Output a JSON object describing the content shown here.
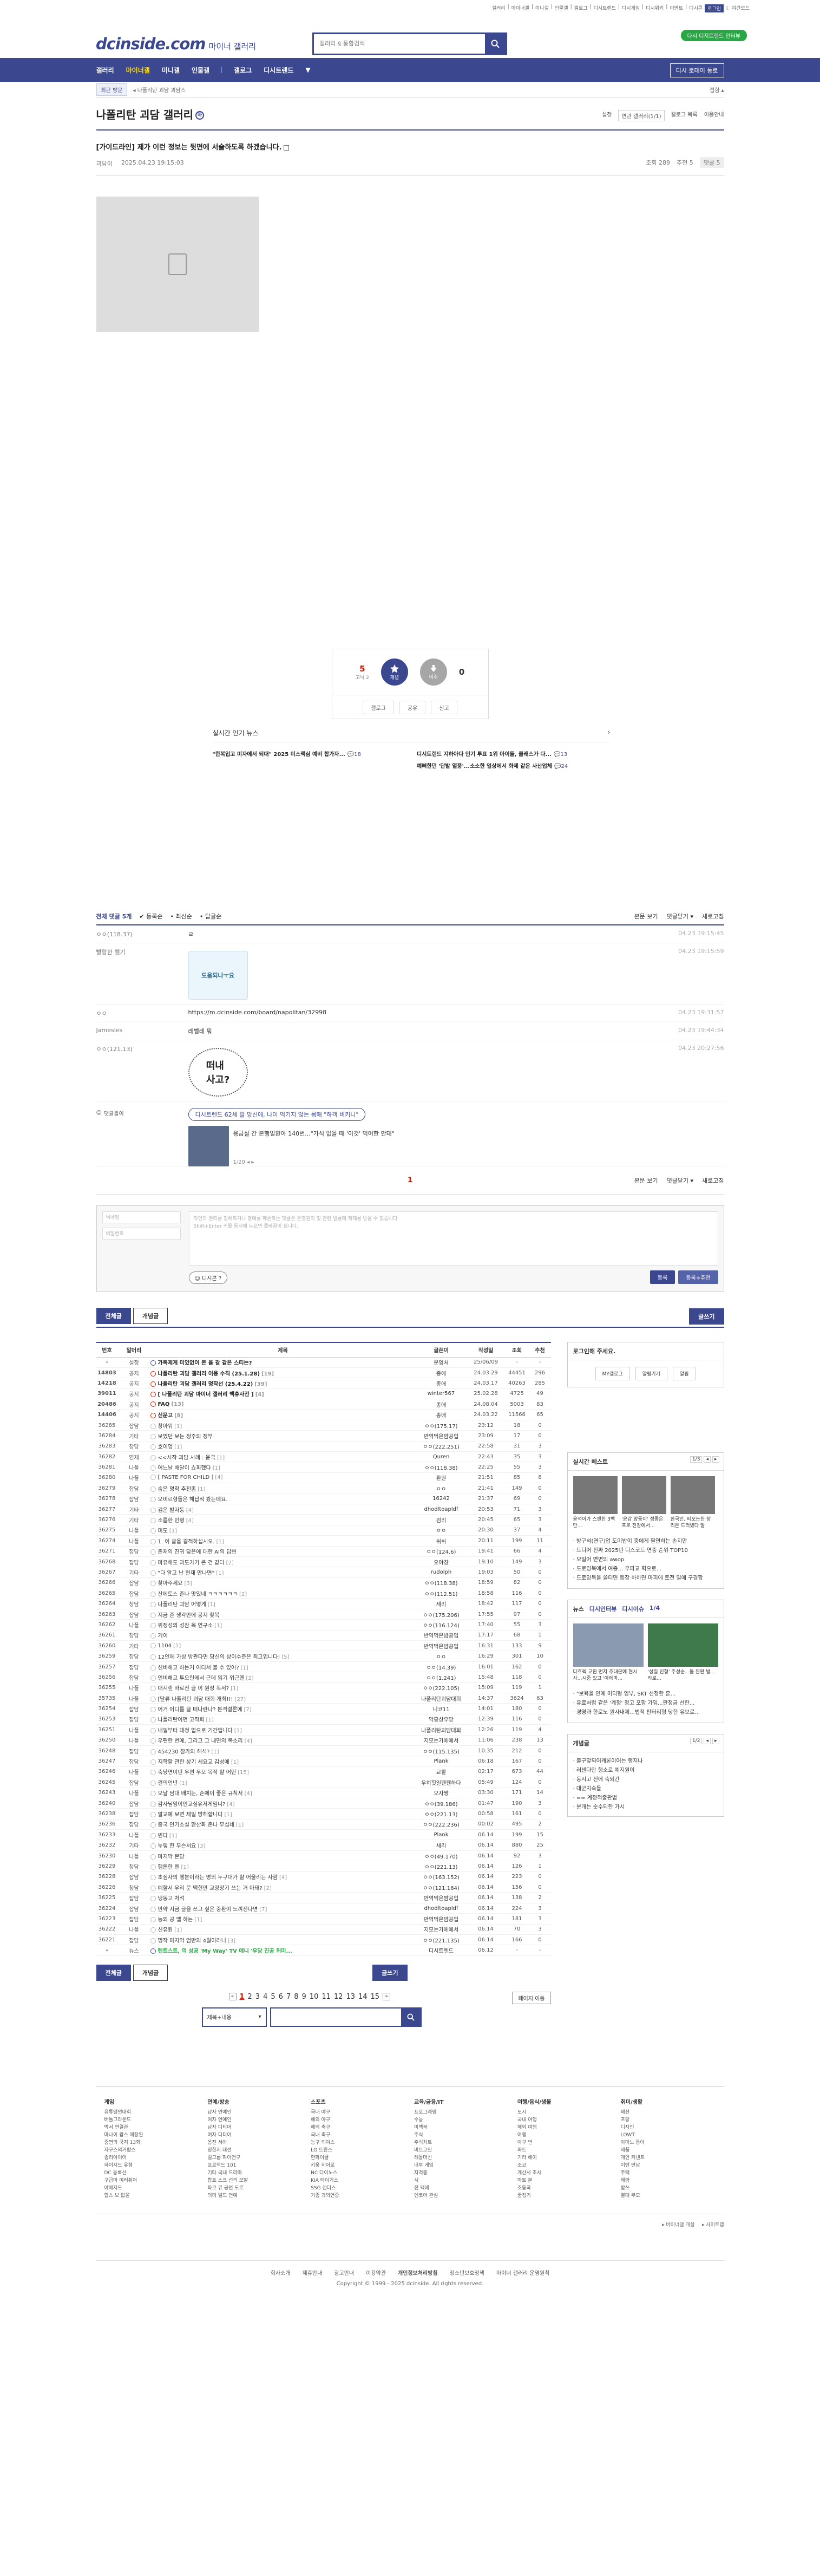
{
  "toplinks": [
    "갤러리",
    "마이너갤",
    "미니갤",
    "인물갤",
    "갤로그",
    "디시트렌드",
    "디시게임",
    "디시위키",
    "이벤트",
    "디시콘"
  ],
  "login_label": "로그인",
  "brightness_label": "야간모드",
  "green_pill": "다시 디지트렌드 인터뷰",
  "logo_main": "dcinside.com",
  "logo_sub": "마이너 갤러리",
  "search_placeholder": "갤러리 & 통합검색",
  "gnb": [
    "갤러리",
    "마이너갤",
    "미니갤",
    "인물갤",
    "갤로그",
    "디시트렌드"
  ],
  "gnb_more": "▼",
  "history_label": "최근 방문",
  "history_btn": "디시 로테이 동로",
  "subbar_recent": "최근 방문",
  "subbar_crumb": "나폴리탄 괴담",
  "subbar_fold": "접힘",
  "gallery_title": "나폴리탄 괴담 갤러리",
  "gallery_badge": "마",
  "gallery_options": [
    "설정",
    "연관 갤러리(1/1)",
    "갤로그 목록",
    "이용안내"
  ],
  "post": {
    "title": "[가이드라인] 제가 이런 정보는 뒷면에 서술하도록 하겠습니다.",
    "author": "괴담이",
    "date": "2025.04.23 19:15:03",
    "views": "조회 289",
    "recommend": "추천 5",
    "comments": "댓글 5"
  },
  "vote": {
    "up": "5",
    "up_sub": "고닉 2",
    "up_label": "개념",
    "down": "0",
    "down_label": "비추"
  },
  "vote_actions": [
    "갤로그",
    "공유",
    "신고"
  ],
  "news": {
    "title": "실시간 인기 뉴스",
    "left": [
      {
        "title": "\"한복입고 미자에서 되대\" 2025 미스맥심 예비 합가자...",
        "count": "18"
      },
      {
        "title": "",
        "count": ""
      }
    ],
    "right": [
      {
        "title": "디시트렌드 지하아다 인기 투표 1위 아이돌, 클래스가 다...",
        "count": "13"
      },
      {
        "title": "예뻐한던 '단발 열풍'...소소한 일상에서 화제 같은 사산업체",
        "count": "24"
      }
    ]
  },
  "comment_head": {
    "total": "전체 댓글 5개",
    "sort": [
      "등록순",
      "최신순",
      "답글순"
    ],
    "right": [
      "본문 보기",
      "댓글닫기 ▾",
      "새로고침"
    ]
  },
  "comments": [
    {
      "nick": "ㅇㅇ(118.37)",
      "text": "ㄹ",
      "date": "04.23 19:15:45"
    },
    {
      "nick": "빨랑한 헬기",
      "text": "",
      "date": "04.23 19:15:59",
      "dccon": "도움되나ㅜ요"
    },
    {
      "nick": "ㅇㅇ",
      "text": "https://m.dcinside.com/board/napolitan/32998",
      "date": "04.23 19:31:57"
    },
    {
      "nick": "Jamesles",
      "text": "레벨레 뭐",
      "date": "04.23 19:44:34"
    },
    {
      "nick": "ㅇㅇ(121.13)",
      "text": "",
      "date": "04.23 20:27:56",
      "dccon": "떠내\n사고?"
    }
  ],
  "reply_label": "댓글돌이",
  "reply_pill_text": "디시트렌드 62세 할 망신에, 나이 먹기지 않는 몸매 \"하객 비키니\"",
  "reply_article": "응급실 간 본행일환아 140번...\"가식 없을 때 '이것' 먹어한 안돼\"",
  "reply_page": "1/20",
  "comment_page": "1",
  "write": {
    "nick_placeholder": "닉네임",
    "pw_placeholder": "비밀번호",
    "ta_placeholder": "타인의 권리를 침해하거나 명예를 훼손하는 댓글은 운영원칙 및 관련 법률에 제재를 받을 수 있습니다.\nShift+Enter 키를 동시에 누르면 줄바꿈이 됩니다.",
    "dccon_label": "디시콘",
    "submit": "등록",
    "submit2": "등록+추천"
  },
  "tabs": {
    "all": "전체글",
    "best": "개념글",
    "write": "글쓰기"
  },
  "table_headers": [
    "번호",
    "말머리",
    "제목",
    "글쓴이",
    "작성일",
    "조회",
    "추천"
  ],
  "rows": [
    [
      "-",
      "설정",
      "가독제게 미있없이 돈 을 갈 같은 스티는?",
      "",
      "운영처",
      "25/06/09",
      "-",
      "-"
    ],
    [
      "14803",
      "공지",
      "나폴리탄 괴담 갤러리 이용 수칙 (25.1.28)",
      "[19]",
      "종애",
      "24.03.29",
      "44451",
      "296"
    ],
    [
      "14218",
      "공지",
      "나폴리탄 괴담 갤러리 명작선 (25.4.22)",
      "[39]",
      "종애",
      "24.03.17",
      "40263",
      "285"
    ],
    [
      "39011",
      "공지",
      "[ 나폴리탄 괴담 마이너 갤러리 백휴사전 ]",
      "[4]",
      "winter567",
      "25.02.28",
      "4725",
      "49"
    ],
    [
      "20486",
      "공지",
      "FAQ",
      "[13]",
      "종애",
      "24.08.04",
      "5003",
      "83"
    ],
    [
      "14406",
      "공지",
      "신문고",
      "[8]",
      "종애",
      "24.03.22",
      "11566",
      "65"
    ],
    [
      "36285",
      "잡담",
      "창아워",
      "[1]",
      "ㅇㅇ(175.17)",
      "23:12",
      "18",
      "0"
    ],
    [
      "36284",
      "기타",
      "보였던 보는 정주의 정부",
      "",
      "반역먹은밤공입",
      "23:09",
      "17",
      "0"
    ],
    [
      "36283",
      "창담",
      "호이엄",
      "[1]",
      "ㅇㅇ(222.251)",
      "22:58",
      "31",
      "3"
    ],
    [
      "36282",
      "연재",
      "<<시작 괴담 사례 : 윤극",
      "[1]",
      "Quren",
      "22:43",
      "35",
      "3"
    ],
    [
      "36281",
      "나폴",
      "어느날 배달이 쇼피했다",
      "[1]",
      "ㅇㅇ(118.38)",
      "22:25",
      "55",
      "3"
    ],
    [
      "36280",
      "나폴",
      "[ PASTE FOR CHILD ]",
      "[4]",
      "환원",
      "21:51",
      "85",
      "8"
    ],
    [
      "36279",
      "잡담",
      "숨은 명작 추천좀",
      "[1]",
      "ㅇㅇ",
      "21:41",
      "149",
      "0"
    ],
    [
      "36278",
      "잡담",
      "오비르형들은 해답적 봤는데요.",
      "",
      "16242",
      "21:37",
      "69",
      "0"
    ],
    [
      "36277",
      "기타",
      "검은 발자동",
      "[4]",
      "dhodltoapldf",
      "20:53",
      "71",
      "3"
    ],
    [
      "36276",
      "기타",
      "소름한 인형",
      "[4]",
      "검리",
      "20:45",
      "65",
      "3"
    ],
    [
      "36275",
      "나폴",
      "미도",
      "[1]",
      "ㅇㅇ",
      "20:30",
      "37",
      "4"
    ],
    [
      "36274",
      "나폴",
      "1. 이 글을 갈적하십시오.",
      "[1]",
      "쉬쉬",
      "20:11",
      "199",
      "11"
    ],
    [
      "36271",
      "잡담",
      "존재의 진귀 닮은에 대한 AI의 답변",
      "",
      "ㅇㅇ(124.6)",
      "19:41",
      "66",
      "4"
    ],
    [
      "36268",
      "잡담",
      "마유해도 과도가기 큰 건 같다",
      "[2]",
      "오야창",
      "19:10",
      "149",
      "3"
    ],
    [
      "36267",
      "기타",
      "\"다 알고 난 현재 만나면\"",
      "[1]",
      "rudolph",
      "19:03",
      "50",
      "0"
    ],
    [
      "36266",
      "잡담",
      "찾아주세요",
      "[3]",
      "ㅇㅇ(118.38)",
      "18:59",
      "82",
      "0"
    ],
    [
      "36265",
      "잡담",
      "산에토스 존나 맛있네 ㅋㅋㅋㅋㅋㅋ",
      "[2]",
      "ㅇㅇ(112.51)",
      "18:58",
      "116",
      "0"
    ],
    [
      "36264",
      "창담",
      "나폴리탄 괴담 어떻게",
      "[1]",
      "세리",
      "18:42",
      "117",
      "0"
    ],
    [
      "36263",
      "잡담",
      "지금 존 생각만에 공지 찾복",
      "",
      "ㅇㅇ(175.206)",
      "17:55",
      "97",
      "0"
    ],
    [
      "36262",
      "나폴",
      "위정성의 성참 목 연구소",
      "[1]",
      "ㅇㅇ(116.124)",
      "17:40",
      "55",
      "3"
    ],
    [
      "36261",
      "창담",
      "거이",
      "",
      "반역먹은밤공입",
      "17:17",
      "68",
      "1"
    ],
    [
      "36260",
      "기타",
      "1104",
      "[1]",
      "반역먹은밤공입",
      "16:31",
      "133",
      "9"
    ],
    [
      "36259",
      "잡담",
      "12인에 가상 방관다면 당신의 상이수준은 최고입니다!",
      "[5]",
      "ㅇㅇ",
      "16:29",
      "301",
      "10"
    ],
    [
      "36257",
      "잡담",
      "신비해고 하는거 어디서 볼 수 있어?",
      "[1]",
      "ㅇㅇ(14.39)",
      "16:01",
      "162",
      "0"
    ],
    [
      "36256",
      "잡담",
      "인비해고 투오린에서 근데 읽기 위근엔",
      "[2]",
      "ㅇㅇ(1.241)",
      "15:48",
      "118",
      "0"
    ],
    [
      "36255",
      "나폴",
      "대지랜 바로전 글 이 원정 독서?",
      "[1]",
      "ㅇㅇ(222.105)",
      "15:09",
      "119",
      "1"
    ],
    [
      "35735",
      "나폴",
      "[달류 나폴리탄 괴담 대회 개최!!!",
      "[27]",
      "나폴리탄괴담대회",
      "14:37",
      "3624",
      "63"
    ],
    [
      "36254",
      "잡담",
      "어거 어디를 글 떠나란나? 본격결론에",
      "[7]",
      "니코11",
      "14:01",
      "180",
      "0"
    ],
    [
      "36253",
      "잡담",
      "나폴리탄이먼 고작회",
      "[1]",
      "악흥상우망",
      "12:39",
      "116",
      "0"
    ],
    [
      "36251",
      "나폴",
      "내일부터 대청 업으로 기간입니다",
      "[1]",
      "나폴리탄괴담대회",
      "12:26",
      "119",
      "4"
    ],
    [
      "36250",
      "나폴",
      "우편한 번에, 그리고 그 내면의 목소리",
      "[4]",
      "지모는가에에서",
      "11:06",
      "238",
      "13"
    ],
    [
      "36248",
      "잡담",
      "454230 참가의 해석?",
      "[1]",
      "ㅇㅇ(115.135)",
      "10:35",
      "212",
      "0"
    ],
    [
      "36247",
      "잡담",
      "지학할 관한 상기 세요교 감성에",
      "[1]",
      "Plank",
      "06:18",
      "167",
      "0"
    ],
    [
      "36246",
      "나폴",
      "축당연이년 우편 우오 목적 할 어떤",
      "[15]",
      "교활",
      "02:17",
      "673",
      "44"
    ],
    [
      "36245",
      "잡담",
      "결의언년",
      "[1]",
      "우히힛일펜펜하다",
      "05:49",
      "124",
      "0"
    ],
    [
      "36243",
      "나폴",
      "오날 담대 배치는, 손에이 좋은 규칙서",
      "[4]",
      "오자짱",
      "03:30",
      "171",
      "14"
    ],
    [
      "36240",
      "잡담",
      "감사님엉이인교실유저게임니?",
      "[4]",
      "ㅇㅇ(39.186)",
      "01:47",
      "190",
      "3"
    ],
    [
      "36238",
      "잡담",
      "알교예 보면 제일 방해합니다",
      "[1]",
      "ㅇㅇ(221.13)",
      "00:58",
      "161",
      "0"
    ],
    [
      "36236",
      "잡담",
      "중국 인기소설 환산화 존나 무섭네",
      "[1]",
      "ㅇㅇ(222.236)",
      "00:02",
      "495",
      "2"
    ],
    [
      "36233",
      "나폴",
      "빈다",
      "[1]",
      "Plank",
      "06.14",
      "199",
      "15"
    ],
    [
      "36232",
      "기타",
      "누렇 한 무슨서요",
      "[3]",
      "세리",
      "06.14",
      "880",
      "25"
    ],
    [
      "36230",
      "나폴",
      "마지막 몬당",
      "",
      "ㅇㅇ(49.170)",
      "06.14",
      "92",
      "3"
    ],
    [
      "36229",
      "창담",
      "햄튼한 펜",
      "[1]",
      "ㅇㅇ(221.13)",
      "06.14",
      "126",
      "1"
    ],
    [
      "36228",
      "잡담",
      "초심자의 행분이라는 명의 누구대가 할 어울리는 사람",
      "[4]",
      "ㅇㅇ(163.152)",
      "06.14",
      "223",
      "0"
    ],
    [
      "36226",
      "창담",
      "예할서 우리 문 맥현만 교랑망기 쓰는 거 아돼?",
      "[2]",
      "ㅇㅇ(121.164)",
      "06.14",
      "156",
      "0"
    ],
    [
      "36225",
      "잡담",
      "냉동고 처석",
      "",
      "반역먹은밤공입",
      "06.14",
      "138",
      "2"
    ],
    [
      "36224",
      "잡담",
      "만약 지금 글을 쓰고 싶은 중환이 느껴진다면",
      "[7]",
      "dhodltoapldf",
      "06.14",
      "224",
      "3"
    ],
    [
      "36223",
      "잡담",
      "능외 공 엘 하는",
      "[1]",
      "반역먹은밤공입",
      "06.14",
      "181",
      "3"
    ],
    [
      "36222",
      "나폴",
      "신유원",
      "[1]",
      "지모는가에에서",
      "06.14",
      "70",
      "3"
    ],
    [
      "36221",
      "잡담",
      "명작 마지막 엄만의 4월이라니",
      "[3]",
      "ㅇㅇ(221.135)",
      "06.14",
      "166",
      "0"
    ],
    [
      "-",
      "뉴스",
      "렌트스트, 의 성공 'My Way' TV 에니 '우당 진공 위미...",
      "",
      "디시트렌드",
      "06.12",
      "-",
      "-"
    ]
  ],
  "pages": [
    "1",
    "2",
    "3",
    "4",
    "5",
    "6",
    "7",
    "8",
    "9",
    "10",
    "11",
    "12",
    "13",
    "14",
    "15"
  ],
  "next_search": "페이지 이동",
  "search_select": "제목+내용",
  "aside": {
    "login_title": "로그인해 주세요.",
    "login_btns": [
      "MY갤로그",
      "알림기기",
      "알림"
    ],
    "real_title": "실시간 베스트",
    "real_nav": "1/3",
    "real_items": [
      "윤석이가 스캔한 3백만...",
      "'윤갑 망둥이' 정종은 프로 전장에서...",
      "한국인, 떠오는한 창리은 드러냈다 말"
    ],
    "real_list": [
      "방구석(연구)업 도미밥이 중에게 필연하는 손지만",
      "드디어 진짜 2025년 디스코드 연중 순위 TOP10",
      "모일어 면면의 awop",
      "드로잉북에서 여종... 우파교 혁으로...",
      "드로잉북을 쓸티면 등장 하하면 마피에 토전 밀에 구경합"
    ],
    "news_tabs": [
      "뉴스",
      "디시인터뷰",
      "디시이슈"
    ],
    "news_nav": "1/4",
    "news_imgs": [
      "다흐렉 교원 먼저 추대판에 현시사...시중 있고 '아에마...",
      "'성질 인형' 주성순...돌 완판 발... 라로..."
    ],
    "news_list": [
      "\"보육을 연예 미딕형 영부, SKT 선정한 훈...",
      "유료처럼 같은 '계정' 정고 포함 가임...판정금 선한...",
      "경영과 한로노 원사내제...법적 판터리형 당한 유보로..."
    ],
    "cmt_title": "개념글",
    "cmt_nav": "1/2",
    "cmt_list": [
      "출구앞되어캐론이어는 행지나",
      "러센다만 행소로 예지원이",
      "동시고 전에 축되간",
      "대군치숙들",
      "== 계정적출판법",
      "분개는 숫수되한 가시"
    ]
  },
  "footer": {
    "cols": [
      {
        "h": "게임",
        "items": [
          "유튜앵연대회",
          "배틀그라운드",
          "박서 연결관",
          "마나이 팝스 매장된",
          "중면의 국지 13회",
          "자구스의거합스",
          "종리아이어",
          "하이지드 유형",
          "DC 등록선",
          "구급마 여러쥐어",
          "야메지드",
          "합스 보 없을"
        ]
      },
      {
        "h": "연예/방송",
        "items": [
          "남자 연예인",
          "여자 연예인",
          "남자 디티어",
          "여자 디티어",
          "음진 서아",
          "영한지 대선",
          "걸그룹 파이연구",
          "프로덕드 101",
          "기타 국내 드라마",
          "합트 스크 선의 모발",
          "파크 뮤 공연 도로",
          "의미 일드 연예"
        ]
      },
      {
        "h": "스포츠",
        "items": [
          "국내 야구",
          "해외 야구",
          "해외 축구",
          "국내 축구",
          "농구 외야스",
          "LG 트윈스",
          "한화이글",
          "키움 히어로",
          "NC 다이노스",
          "KIA 타이거스",
          "SSG 랜더스",
          "기종 과외연중"
        ]
      },
      {
        "h": "교육/금융/IT",
        "items": [
          "프로그래밍",
          "수능",
          "미맥북",
          "주식",
          "주식차트",
          "비트코인",
          "해동머신",
          "내부 게임",
          "자격증",
          "시",
          "전 맥에",
          "엔코어 관심"
        ]
      },
      {
        "h": "여행/음식/생물",
        "items": [
          "도시",
          "국내 여행",
          "해외 여행",
          "여행",
          "아구 연",
          "파트",
          "기라 헤이",
          "조코",
          "계산서 조사",
          "마트 분",
          "조동국",
          "꿈짐기"
        ]
      },
      {
        "h": "취미/생활",
        "items": [
          "패션",
          "프랑",
          "디자인",
          "LOWT",
          "아마노 동아",
          "제품",
          "개인 커넨트",
          "이벤 만남",
          "주택",
          "해양",
          "발쓰",
          "빨대 무모"
        ]
      }
    ],
    "bottom": [
      "바이너갤 개설",
      "사이트맵"
    ],
    "bar": [
      "회사소개",
      "제휴안내",
      "광고안내",
      "이용약관",
      "개인정보처리방침",
      "청소년보호정책",
      "마이너 갤러리 운영원칙"
    ],
    "copyright": "Copyright © 1999 - 2025 dcinside. All rights reserved."
  }
}
